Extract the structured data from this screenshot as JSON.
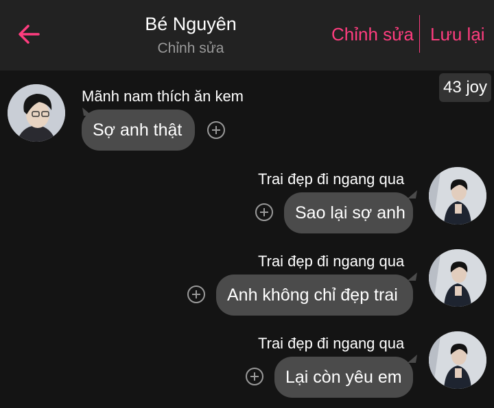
{
  "header": {
    "back_icon": "arrow-left-icon",
    "title": "Bé Nguyên",
    "subtitle": "Chỉnh sửa",
    "edit_label": "Chỉnh sửa",
    "save_label": "Lưu lại",
    "accent_color": "#ff3d7f"
  },
  "badge": {
    "label": "43 joy"
  },
  "messages": [
    {
      "side": "left",
      "sender": "Mãnh nam thích ăn kem",
      "text": "Sợ anh thật"
    },
    {
      "side": "right",
      "sender": "Trai đẹp đi ngang qua",
      "text": "Sao lại sợ anh"
    },
    {
      "side": "right",
      "sender": "Trai đẹp đi ngang qua",
      "text": "Anh không chỉ đẹp trai"
    },
    {
      "side": "right",
      "sender": "Trai đẹp đi ngang qua",
      "text": "Lại còn yêu em"
    }
  ],
  "colors": {
    "background": "#141414",
    "header": "#222222",
    "bubble": "#4b4b4b"
  }
}
